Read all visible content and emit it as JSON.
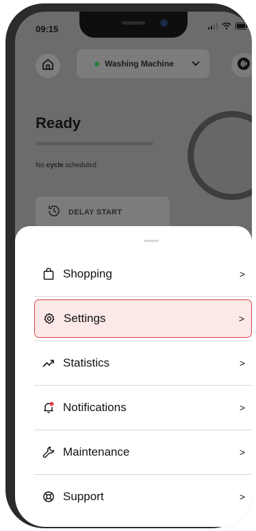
{
  "status_bar": {
    "time": "09:15"
  },
  "header": {
    "device_name": "Washing Machine"
  },
  "main": {
    "status_title": "Ready",
    "schedule_prefix": "No",
    "schedule_bold": "cycle",
    "schedule_suffix": "scheduled",
    "delay_label": "DELAY START"
  },
  "menu": {
    "items": [
      {
        "label": "Shopping",
        "icon": "shopping-bag-icon"
      },
      {
        "label": "Settings",
        "icon": "gear-icon",
        "selected": true
      },
      {
        "label": "Statistics",
        "icon": "trend-up-icon"
      },
      {
        "label": "Notifications",
        "icon": "bell-icon"
      },
      {
        "label": "Maintenance",
        "icon": "wrench-icon"
      },
      {
        "label": "Support",
        "icon": "lifebuoy-icon"
      }
    ],
    "chevron": ">"
  },
  "colors": {
    "accent": "#d8434b",
    "selected_bg": "#fde8e8",
    "status_green": "#2f7a3b"
  }
}
